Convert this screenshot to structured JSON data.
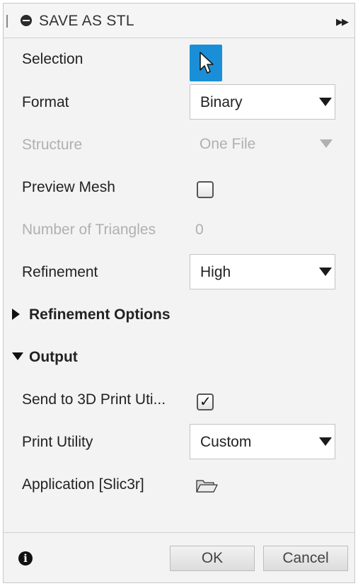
{
  "title": "SAVE AS STL",
  "fields": {
    "selection": {
      "label": "Selection"
    },
    "format": {
      "label": "Format",
      "value": "Binary"
    },
    "structure": {
      "label": "Structure",
      "value": "One File"
    },
    "preview_mesh": {
      "label": "Preview Mesh",
      "checked": false
    },
    "number_of_triangles": {
      "label": "Number of Triangles",
      "value": "0"
    },
    "refinement": {
      "label": "Refinement",
      "value": "High"
    },
    "refinement_options": {
      "label": "Refinement Options",
      "expanded": false
    },
    "output": {
      "label": "Output",
      "expanded": true
    },
    "send_to_print": {
      "label": "Send to 3D Print Uti...",
      "checked": true
    },
    "print_utility": {
      "label": "Print Utility",
      "value": "Custom"
    },
    "application": {
      "label": "Application [Slic3r]"
    }
  },
  "footer": {
    "info_icon_glyph": "i",
    "ok_label": "OK",
    "cancel_label": "Cancel"
  },
  "icons": {
    "selection": "cursor-arrow-icon",
    "application": "folder-open-icon",
    "title": "minus-circle-icon",
    "expand": "double-chevron-right-icon"
  },
  "colors": {
    "accent": "#1a8fd8",
    "disabled_text": "#b0b0b0"
  }
}
